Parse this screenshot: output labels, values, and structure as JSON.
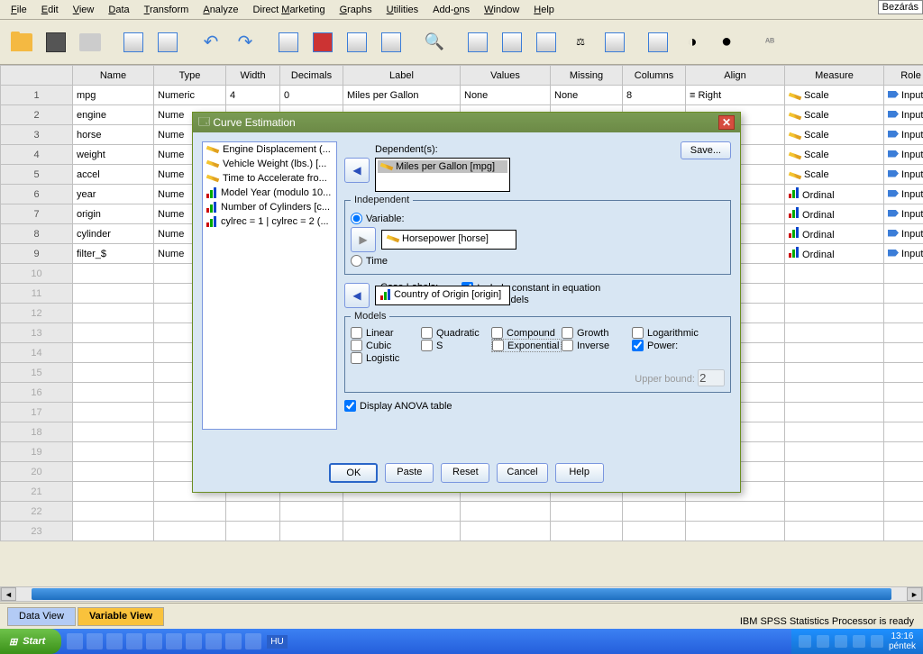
{
  "close_label": "Bezárás",
  "menu": {
    "file": "File",
    "edit": "Edit",
    "view": "View",
    "data": "Data",
    "transform": "Transform",
    "analyze": "Analyze",
    "dm": "Direct Marketing",
    "graphs": "Graphs",
    "utilities": "Utilities",
    "addons": "Add-ons",
    "window": "Window",
    "help": "Help"
  },
  "columns": [
    "Name",
    "Type",
    "Width",
    "Decimals",
    "Label",
    "Values",
    "Missing",
    "Columns",
    "Align",
    "Measure",
    "Role"
  ],
  "rows": [
    {
      "n": "1",
      "name": "mpg",
      "type": "Numeric",
      "width": "4",
      "dec": "0",
      "label": "Miles per Gallon",
      "values": "None",
      "missing": "None",
      "cols": "8",
      "align": "Right",
      "measure": "Scale",
      "mico": "scale",
      "role": "Input"
    },
    {
      "n": "2",
      "name": "engine",
      "type": "Nume",
      "measure": "Scale",
      "mico": "scale",
      "role": "Input"
    },
    {
      "n": "3",
      "name": "horse",
      "type": "Nume",
      "measure": "Scale",
      "mico": "scale",
      "role": "Input"
    },
    {
      "n": "4",
      "name": "weight",
      "type": "Nume",
      "measure": "Scale",
      "mico": "scale",
      "role": "Input"
    },
    {
      "n": "5",
      "name": "accel",
      "type": "Nume",
      "measure": "Scale",
      "mico": "scale",
      "role": "Input"
    },
    {
      "n": "6",
      "name": "year",
      "type": "Nume",
      "measure": "Ordinal",
      "mico": "ord",
      "role": "Input"
    },
    {
      "n": "7",
      "name": "origin",
      "type": "Nume",
      "measure": "Ordinal",
      "mico": "ord",
      "role": "Input"
    },
    {
      "n": "8",
      "name": "cylinder",
      "type": "Nume",
      "measure": "Ordinal",
      "mico": "ord",
      "role": "Input"
    },
    {
      "n": "9",
      "name": "filter_$",
      "type": "Nume",
      "measure": "Ordinal",
      "mico": "ord",
      "role": "Input"
    }
  ],
  "blank_rows": [
    "10",
    "11",
    "12",
    "13",
    "14",
    "15",
    "16",
    "17",
    "18",
    "19",
    "20",
    "21",
    "22",
    "23"
  ],
  "dialog": {
    "title": "Curve Estimation",
    "vars": [
      {
        "ico": "scale",
        "t": "Engine Displacement (..."
      },
      {
        "ico": "scale",
        "t": "Vehicle Weight (lbs.) [..."
      },
      {
        "ico": "scale",
        "t": "Time to Accelerate fro..."
      },
      {
        "ico": "ord",
        "t": "Model Year (modulo 10..."
      },
      {
        "ico": "ord",
        "t": "Number of Cylinders [c..."
      },
      {
        "ico": "ord",
        "t": "cylrec = 1 | cylrec = 2 (..."
      }
    ],
    "dependents_label": "Dependent(s):",
    "dependent": "Miles per Gallon [mpg]",
    "independent_legend": "Independent",
    "var_radio": "Variable:",
    "time_radio": "Time",
    "ind_var": "Horsepower [horse]",
    "case_labels": "Case Labels:",
    "case_var": "Country of Origin [origin]",
    "inc_const": "Include constant in equation",
    "plot": "Plot models",
    "models_legend": "Models",
    "m": {
      "lin": "Linear",
      "log": "Logarithmic",
      "inv": "Inverse",
      "quad": "Quadratic",
      "cub": "Cubic",
      "pow": "Power:",
      "comp": "Compound",
      "s": "S",
      "logi": "Logistic",
      "grow": "Growth",
      "exp": "Exponential"
    },
    "upper": "Upper bound:",
    "upper_val": "2",
    "disp_anova": "Display ANOVA table",
    "save": "Save...",
    "ok": "OK",
    "paste": "Paste",
    "reset": "Reset",
    "cancel": "Cancel",
    "help": "Help"
  },
  "tabs": {
    "data": "Data View",
    "var": "Variable View"
  },
  "status": "IBM SPSS Statistics Processor is ready",
  "start": "Start",
  "lang": "HU",
  "clock": {
    "t": "13:16",
    "d": "péntek"
  }
}
